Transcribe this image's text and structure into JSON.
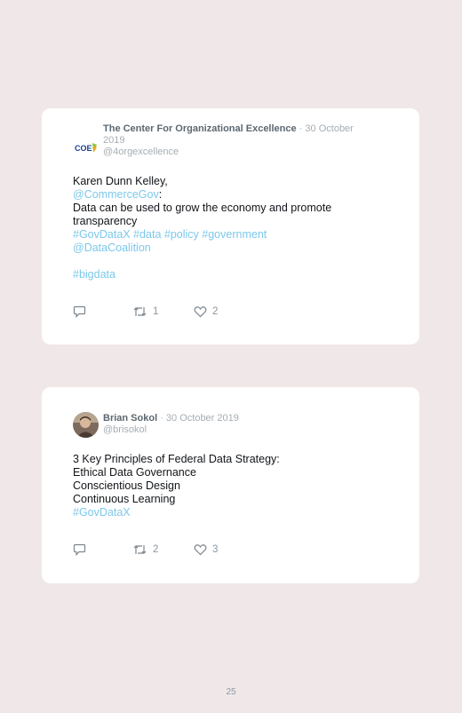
{
  "tweets": [
    {
      "author": "The Center For Organizational Excellence",
      "date": "30 October 2019",
      "handle": "@4orgexcellence",
      "avatar_text": "COE",
      "lines": [
        [
          {
            "t": "Karen Dunn Kelley,",
            "link": false
          }
        ],
        [
          {
            "t": "@CommerceGov",
            "link": true
          },
          {
            "t": ":",
            "link": false
          }
        ],
        [
          {
            "t": "Data can be used to grow the economy and promote transparency",
            "link": false
          }
        ],
        [
          {
            "t": "#GovDataX",
            "link": true
          },
          {
            "t": " ",
            "link": false
          },
          {
            "t": "#data",
            "link": true
          },
          {
            "t": " ",
            "link": false
          },
          {
            "t": "#policy",
            "link": true
          },
          {
            "t": " ",
            "link": false
          },
          {
            "t": "#government",
            "link": true
          }
        ],
        [
          {
            "t": "@DataCoalition",
            "link": true
          }
        ],
        [],
        [
          {
            "t": "#bigdata",
            "link": true
          }
        ]
      ],
      "retweets": "1",
      "likes": "2"
    },
    {
      "author": "Brian Sokol",
      "date": "30 October 2019",
      "handle": "@brisokol",
      "avatar_text": "",
      "lines": [
        [
          {
            "t": "3 Key Principles of Federal Data Strategy:",
            "link": false
          }
        ],
        [
          {
            "t": "Ethical Data Governance",
            "link": false
          }
        ],
        [
          {
            "t": "Conscientious Design",
            "link": false
          }
        ],
        [
          {
            "t": "Continuous Learning",
            "link": false
          }
        ],
        [
          {
            "t": "#GovDataX",
            "link": true
          }
        ]
      ],
      "retweets": "2",
      "likes": "3"
    }
  ],
  "page_number": "25",
  "colors": {
    "background": "#f0e8e8",
    "link": "#7cc8ea",
    "author": "#5c6770",
    "meta": "#a6adb3"
  },
  "icons": {
    "reply": "reply-icon",
    "retweet": "retweet-icon",
    "like": "heart-icon"
  }
}
